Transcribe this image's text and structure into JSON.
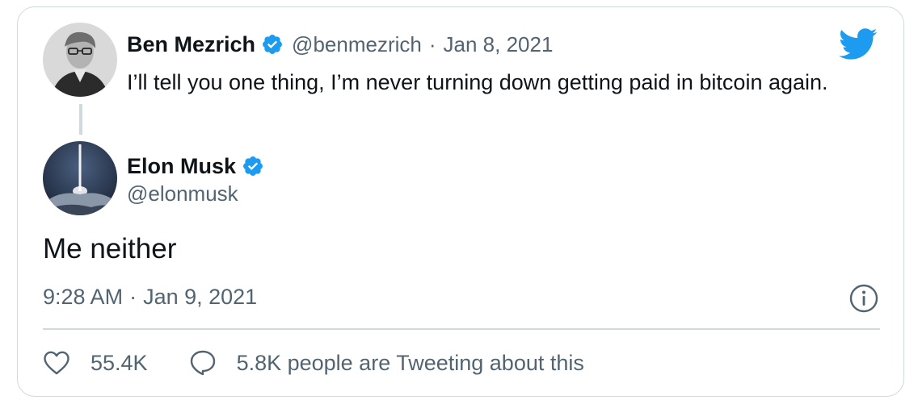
{
  "quoted_tweet": {
    "author_name": "Ben Mezrich",
    "handle": "@benmezrich",
    "separator": "·",
    "date": "Jan 8, 2021",
    "text": "I’ll tell you one thing, I’m never turning down getting paid in bitcoin again."
  },
  "tweet": {
    "author_name": "Elon Musk",
    "handle": "@elonmusk",
    "text": "Me neither",
    "time": "9:28 AM",
    "separator": "·",
    "date": "Jan 9, 2021"
  },
  "actions": {
    "likes": "55.4K",
    "tweeting_about": "5.8K people are Tweeting about this"
  },
  "icons": {
    "brand": "twitter-bird-icon",
    "verified": "verified-badge-icon",
    "info": "info-icon",
    "like": "heart-icon",
    "reply": "speech-bubble-icon"
  },
  "colors": {
    "twitter_blue": "#1d9bf0",
    "text": "#0f1419",
    "muted": "#536471",
    "border": "#cfd9de"
  }
}
